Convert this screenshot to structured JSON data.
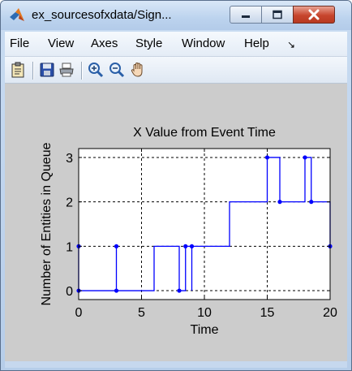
{
  "window": {
    "title": "ex_sourcesofxdata/Sign...",
    "app_icon": "matlab-logo-icon",
    "controls": {
      "minimize_icon": "minimize-icon",
      "maximize_icon": "maximize-icon",
      "close_icon": "close-icon"
    }
  },
  "menubar": {
    "items": [
      {
        "label": "File"
      },
      {
        "label": "View"
      },
      {
        "label": "Axes"
      },
      {
        "label": "Style"
      },
      {
        "label": "Window"
      },
      {
        "label": "Help"
      }
    ],
    "overflow_glyph": "↘"
  },
  "toolbar": {
    "items": [
      {
        "icon": "clipboard-icon"
      },
      {
        "icon": "save-icon"
      },
      {
        "icon": "print-icon"
      },
      {
        "icon": "zoom-in-icon"
      },
      {
        "icon": "zoom-out-icon"
      },
      {
        "icon": "pan-hand-icon"
      }
    ]
  },
  "colors": {
    "plot_line": "#0000ff",
    "figure_bg": "#cccccc",
    "axes_bg": "#ffffff",
    "close_button": "#c7452d"
  },
  "chart_data": {
    "type": "line",
    "step": true,
    "title": "X Value from Event Time",
    "xlabel": "Time",
    "ylabel": "Number of Entities in Queue",
    "xlim": [
      0,
      20
    ],
    "ylim": [
      -0.2,
      3.2
    ],
    "xticks": [
      0,
      5,
      10,
      15,
      20
    ],
    "yticks": [
      0,
      1,
      2,
      3
    ],
    "grid": true,
    "series": [
      {
        "points": [
          [
            0,
            1
          ],
          [
            0,
            0
          ],
          [
            3,
            0
          ],
          [
            3,
            1
          ],
          [
            3,
            0
          ],
          [
            6,
            0
          ],
          [
            6,
            1
          ],
          [
            8,
            1
          ],
          [
            8,
            0
          ],
          [
            8.5,
            0
          ],
          [
            8.5,
            1
          ],
          [
            9,
            1
          ],
          [
            9,
            0
          ],
          [
            9,
            1
          ],
          [
            12,
            1
          ],
          [
            12,
            2
          ],
          [
            15,
            2
          ],
          [
            15,
            3
          ],
          [
            16,
            3
          ],
          [
            16,
            2
          ],
          [
            18,
            2
          ],
          [
            18,
            3
          ],
          [
            18.5,
            3
          ],
          [
            18.5,
            2
          ],
          [
            20,
            2
          ],
          [
            20,
            1
          ]
        ],
        "markers": [
          [
            0,
            1
          ],
          [
            0,
            0
          ],
          [
            3,
            1
          ],
          [
            3,
            0
          ],
          [
            8,
            0
          ],
          [
            8.5,
            1
          ],
          [
            9,
            1
          ],
          [
            15,
            3
          ],
          [
            16,
            2
          ],
          [
            18,
            3
          ],
          [
            18.5,
            2
          ],
          [
            20,
            1
          ]
        ]
      }
    ]
  }
}
